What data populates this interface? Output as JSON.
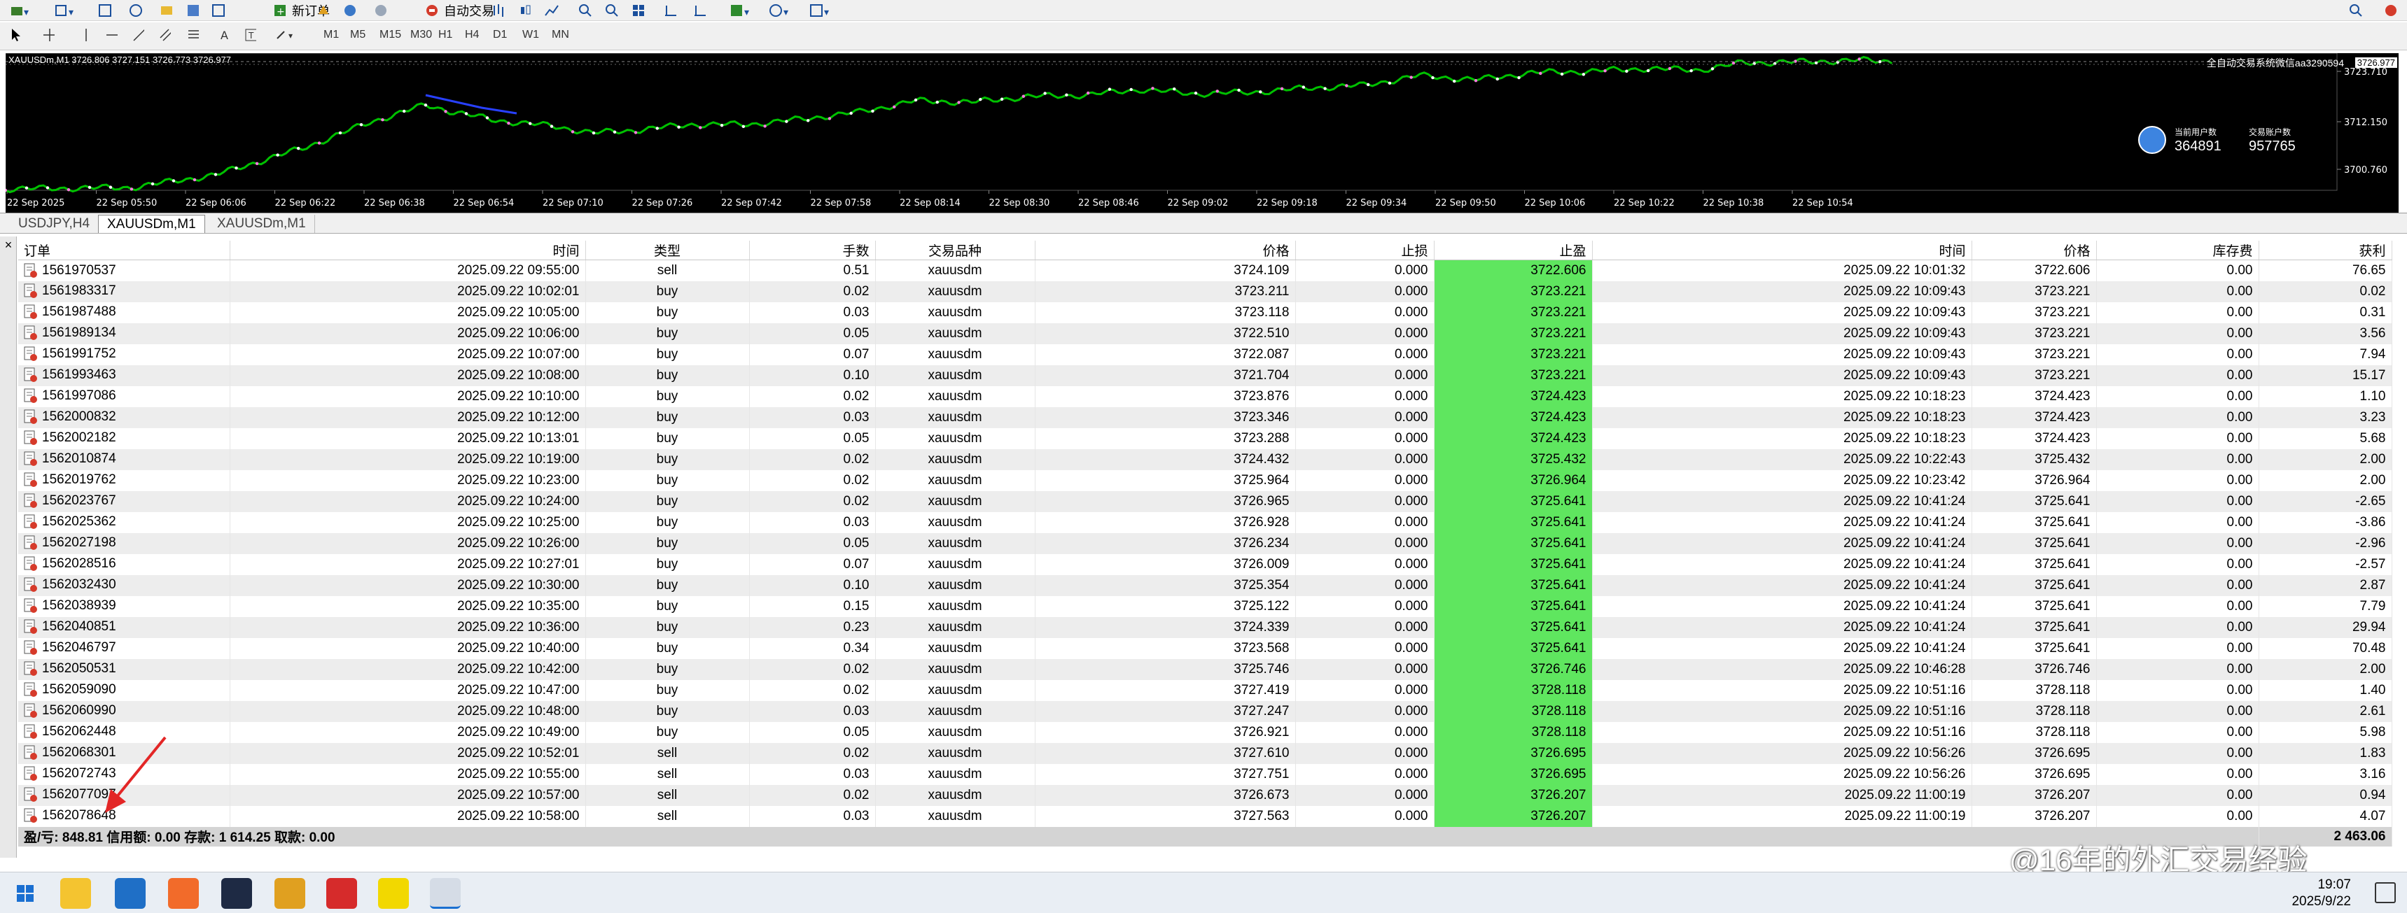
{
  "toolbar": {
    "new_order_label": "新订单",
    "auto_trading_label": "自动交易"
  },
  "timeframes": [
    "M1",
    "M5",
    "M15",
    "M30",
    "H1",
    "H4",
    "D1",
    "W1",
    "MN"
  ],
  "chart": {
    "header": "XAUUSDm,M1 3726.806 3727.151 3726.773 3726.977",
    "overlay_notice": "全自动交易系统微信aa3290594",
    "current_price": "3726.977",
    "price_labels": [
      "3723.710",
      "3712.150",
      "3700.760"
    ],
    "time_labels": [
      "22 Sep 2025",
      "22 Sep 05:50",
      "22 Sep 06:06",
      "22 Sep 06:22",
      "22 Sep 06:38",
      "22 Sep 06:54",
      "22 Sep 07:10",
      "22 Sep 07:26",
      "22 Sep 07:42",
      "22 Sep 07:58",
      "22 Sep 08:14",
      "22 Sep 08:30",
      "22 Sep 08:46",
      "22 Sep 09:02",
      "22 Sep 09:18",
      "22 Sep 09:34",
      "22 Sep 09:50",
      "22 Sep 10:06",
      "22 Sep 10:22",
      "22 Sep 10:38",
      "22 Sep 10:54"
    ],
    "widget_left_label": "当前用户数",
    "widget_left_value": "364891",
    "widget_right_label": "交易账户数",
    "widget_right_value": "957765",
    "bg_color": "#000000",
    "line_color": "#00c000"
  },
  "chart_tabs": [
    "USDJPY,H4",
    "XAUUSDm,M1",
    "XAUUSDm,M1"
  ],
  "history": {
    "columns": [
      "订单",
      "时间",
      "类型",
      "手数",
      "交易品种",
      "价格",
      "止损",
      "止盈",
      "时间",
      "价格",
      "库存费",
      "获利"
    ],
    "rows": [
      [
        "1561970537",
        "2025.09.22 09:55:00",
        "sell",
        "0.51",
        "xauusdm",
        "3724.109",
        "0.000",
        "3722.606",
        "2025.09.22 10:01:32",
        "3722.606",
        "0.00",
        "76.65"
      ],
      [
        "1561983317",
        "2025.09.22 10:02:01",
        "buy",
        "0.02",
        "xauusdm",
        "3723.211",
        "0.000",
        "3723.221",
        "2025.09.22 10:09:43",
        "3723.221",
        "0.00",
        "0.02"
      ],
      [
        "1561987488",
        "2025.09.22 10:05:00",
        "buy",
        "0.03",
        "xauusdm",
        "3723.118",
        "0.000",
        "3723.221",
        "2025.09.22 10:09:43",
        "3723.221",
        "0.00",
        "0.31"
      ],
      [
        "1561989134",
        "2025.09.22 10:06:00",
        "buy",
        "0.05",
        "xauusdm",
        "3722.510",
        "0.000",
        "3723.221",
        "2025.09.22 10:09:43",
        "3723.221",
        "0.00",
        "3.56"
      ],
      [
        "1561991752",
        "2025.09.22 10:07:00",
        "buy",
        "0.07",
        "xauusdm",
        "3722.087",
        "0.000",
        "3723.221",
        "2025.09.22 10:09:43",
        "3723.221",
        "0.00",
        "7.94"
      ],
      [
        "1561993463",
        "2025.09.22 10:08:00",
        "buy",
        "0.10",
        "xauusdm",
        "3721.704",
        "0.000",
        "3723.221",
        "2025.09.22 10:09:43",
        "3723.221",
        "0.00",
        "15.17"
      ],
      [
        "1561997086",
        "2025.09.22 10:10:00",
        "buy",
        "0.02",
        "xauusdm",
        "3723.876",
        "0.000",
        "3724.423",
        "2025.09.22 10:18:23",
        "3724.423",
        "0.00",
        "1.10"
      ],
      [
        "1562000832",
        "2025.09.22 10:12:00",
        "buy",
        "0.03",
        "xauusdm",
        "3723.346",
        "0.000",
        "3724.423",
        "2025.09.22 10:18:23",
        "3724.423",
        "0.00",
        "3.23"
      ],
      [
        "1562002182",
        "2025.09.22 10:13:01",
        "buy",
        "0.05",
        "xauusdm",
        "3723.288",
        "0.000",
        "3724.423",
        "2025.09.22 10:18:23",
        "3724.423",
        "0.00",
        "5.68"
      ],
      [
        "1562010874",
        "2025.09.22 10:19:00",
        "buy",
        "0.02",
        "xauusdm",
        "3724.432",
        "0.000",
        "3725.432",
        "2025.09.22 10:22:43",
        "3725.432",
        "0.00",
        "2.00"
      ],
      [
        "1562019762",
        "2025.09.22 10:23:00",
        "buy",
        "0.02",
        "xauusdm",
        "3725.964",
        "0.000",
        "3726.964",
        "2025.09.22 10:23:42",
        "3726.964",
        "0.00",
        "2.00"
      ],
      [
        "1562023767",
        "2025.09.22 10:24:00",
        "buy",
        "0.02",
        "xauusdm",
        "3726.965",
        "0.000",
        "3725.641",
        "2025.09.22 10:41:24",
        "3725.641",
        "0.00",
        "-2.65"
      ],
      [
        "1562025362",
        "2025.09.22 10:25:00",
        "buy",
        "0.03",
        "xauusdm",
        "3726.928",
        "0.000",
        "3725.641",
        "2025.09.22 10:41:24",
        "3725.641",
        "0.00",
        "-3.86"
      ],
      [
        "1562027198",
        "2025.09.22 10:26:00",
        "buy",
        "0.05",
        "xauusdm",
        "3726.234",
        "0.000",
        "3725.641",
        "2025.09.22 10:41:24",
        "3725.641",
        "0.00",
        "-2.96"
      ],
      [
        "1562028516",
        "2025.09.22 10:27:01",
        "buy",
        "0.07",
        "xauusdm",
        "3726.009",
        "0.000",
        "3725.641",
        "2025.09.22 10:41:24",
        "3725.641",
        "0.00",
        "-2.57"
      ],
      [
        "1562032430",
        "2025.09.22 10:30:00",
        "buy",
        "0.10",
        "xauusdm",
        "3725.354",
        "0.000",
        "3725.641",
        "2025.09.22 10:41:24",
        "3725.641",
        "0.00",
        "2.87"
      ],
      [
        "1562038939",
        "2025.09.22 10:35:00",
        "buy",
        "0.15",
        "xauusdm",
        "3725.122",
        "0.000",
        "3725.641",
        "2025.09.22 10:41:24",
        "3725.641",
        "0.00",
        "7.79"
      ],
      [
        "1562040851",
        "2025.09.22 10:36:00",
        "buy",
        "0.23",
        "xauusdm",
        "3724.339",
        "0.000",
        "3725.641",
        "2025.09.22 10:41:24",
        "3725.641",
        "0.00",
        "29.94"
      ],
      [
        "1562046797",
        "2025.09.22 10:40:00",
        "buy",
        "0.34",
        "xauusdm",
        "3723.568",
        "0.000",
        "3725.641",
        "2025.09.22 10:41:24",
        "3725.641",
        "0.00",
        "70.48"
      ],
      [
        "1562050531",
        "2025.09.22 10:42:00",
        "buy",
        "0.02",
        "xauusdm",
        "3725.746",
        "0.000",
        "3726.746",
        "2025.09.22 10:46:28",
        "3726.746",
        "0.00",
        "2.00"
      ],
      [
        "1562059090",
        "2025.09.22 10:47:00",
        "buy",
        "0.02",
        "xauusdm",
        "3727.419",
        "0.000",
        "3728.118",
        "2025.09.22 10:51:16",
        "3728.118",
        "0.00",
        "1.40"
      ],
      [
        "1562060990",
        "2025.09.22 10:48:00",
        "buy",
        "0.03",
        "xauusdm",
        "3727.247",
        "0.000",
        "3728.118",
        "2025.09.22 10:51:16",
        "3728.118",
        "0.00",
        "2.61"
      ],
      [
        "1562062448",
        "2025.09.22 10:49:00",
        "buy",
        "0.05",
        "xauusdm",
        "3726.921",
        "0.000",
        "3728.118",
        "2025.09.22 10:51:16",
        "3728.118",
        "0.00",
        "5.98"
      ],
      [
        "1562068301",
        "2025.09.22 10:52:01",
        "sell",
        "0.02",
        "xauusdm",
        "3727.610",
        "0.000",
        "3726.695",
        "2025.09.22 10:56:26",
        "3726.695",
        "0.00",
        "1.83"
      ],
      [
        "1562072743",
        "2025.09.22 10:55:00",
        "sell",
        "0.03",
        "xauusdm",
        "3727.751",
        "0.000",
        "3726.695",
        "2025.09.22 10:56:26",
        "3726.695",
        "0.00",
        "3.16"
      ],
      [
        "1562077097",
        "2025.09.22 10:57:00",
        "sell",
        "0.02",
        "xauusdm",
        "3726.673",
        "0.000",
        "3726.207",
        "2025.09.22 11:00:19",
        "3726.207",
        "0.00",
        "0.94"
      ],
      [
        "1562078648",
        "2025.09.22 10:58:00",
        "sell",
        "0.03",
        "xauusdm",
        "3727.563",
        "0.000",
        "3726.207",
        "2025.09.22 11:00:19",
        "3726.207",
        "0.00",
        "4.07"
      ]
    ],
    "summary_label": "盈/亏: 848.81  信用额: 0.00  存款: 1 614.25  取款: 0.00",
    "summary_total": "2 463.06",
    "tp_highlight_color": "#5fe65f"
  },
  "taskbar": {
    "time": "19:07",
    "date": "2025/9/22"
  },
  "watermark": "@16年的外汇交易经验"
}
